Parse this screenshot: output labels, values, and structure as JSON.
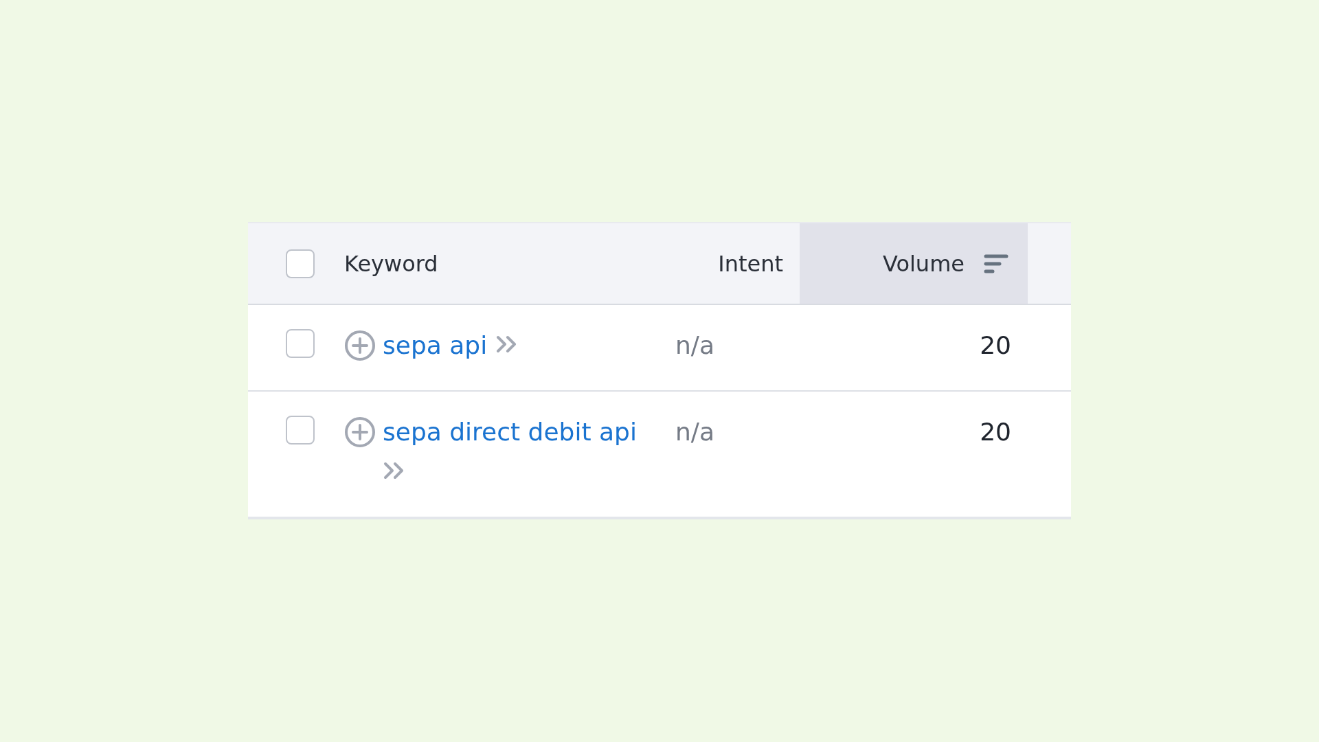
{
  "table": {
    "select_all": {
      "checked": false
    },
    "columns": [
      {
        "label": "Keyword",
        "sorted": false
      },
      {
        "label": "Intent",
        "sorted": false
      },
      {
        "label": "Volume",
        "sorted": true
      }
    ],
    "rows": [
      {
        "checked": false,
        "keyword": "sepa api",
        "intent": "n/a",
        "volume": "20"
      },
      {
        "checked": false,
        "keyword": "sepa direct debit api",
        "intent": "n/a",
        "volume": "20"
      }
    ]
  }
}
